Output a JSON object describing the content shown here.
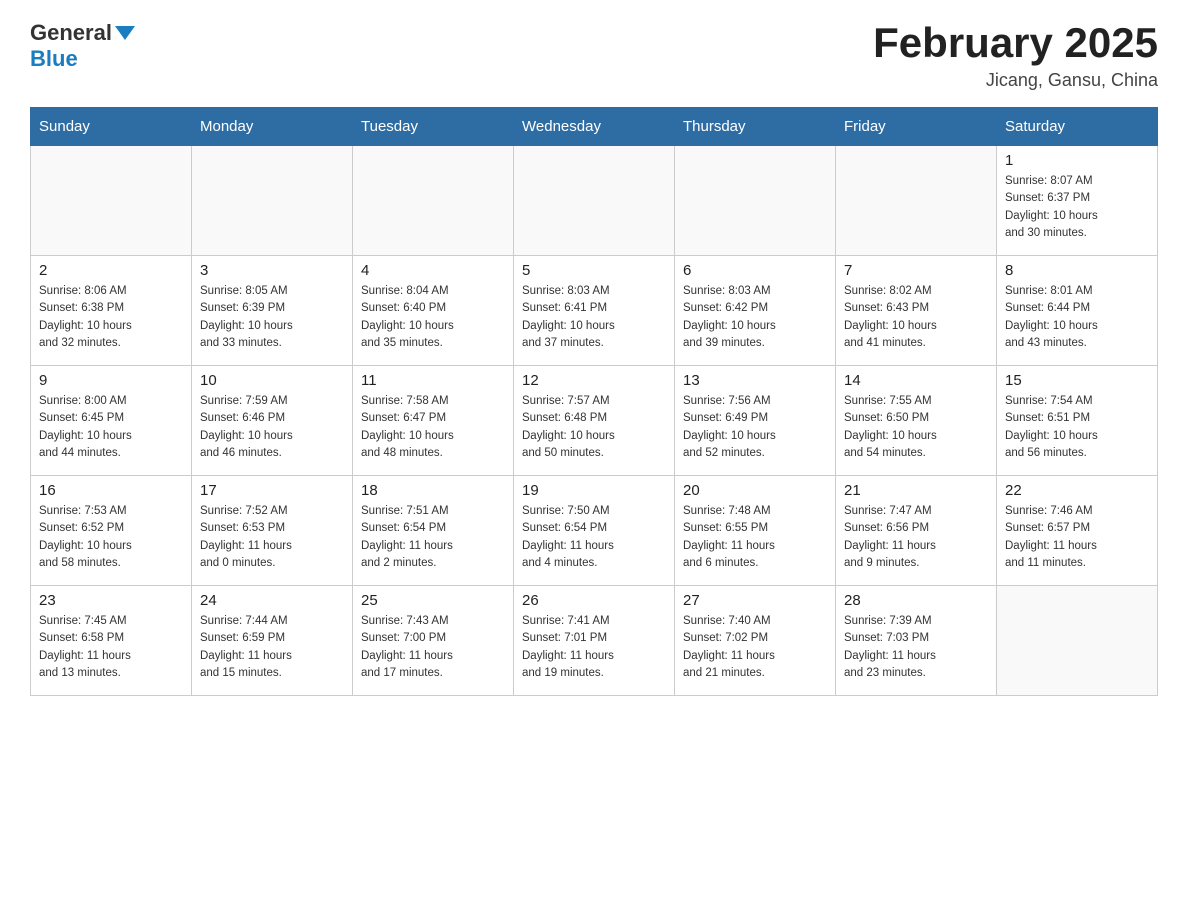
{
  "header": {
    "logo_general": "General",
    "logo_blue": "Blue",
    "month_title": "February 2025",
    "location": "Jicang, Gansu, China"
  },
  "days_of_week": [
    "Sunday",
    "Monday",
    "Tuesday",
    "Wednesday",
    "Thursday",
    "Friday",
    "Saturday"
  ],
  "weeks": [
    [
      {
        "day": "",
        "info": ""
      },
      {
        "day": "",
        "info": ""
      },
      {
        "day": "",
        "info": ""
      },
      {
        "day": "",
        "info": ""
      },
      {
        "day": "",
        "info": ""
      },
      {
        "day": "",
        "info": ""
      },
      {
        "day": "1",
        "info": "Sunrise: 8:07 AM\nSunset: 6:37 PM\nDaylight: 10 hours\nand 30 minutes."
      }
    ],
    [
      {
        "day": "2",
        "info": "Sunrise: 8:06 AM\nSunset: 6:38 PM\nDaylight: 10 hours\nand 32 minutes."
      },
      {
        "day": "3",
        "info": "Sunrise: 8:05 AM\nSunset: 6:39 PM\nDaylight: 10 hours\nand 33 minutes."
      },
      {
        "day": "4",
        "info": "Sunrise: 8:04 AM\nSunset: 6:40 PM\nDaylight: 10 hours\nand 35 minutes."
      },
      {
        "day": "5",
        "info": "Sunrise: 8:03 AM\nSunset: 6:41 PM\nDaylight: 10 hours\nand 37 minutes."
      },
      {
        "day": "6",
        "info": "Sunrise: 8:03 AM\nSunset: 6:42 PM\nDaylight: 10 hours\nand 39 minutes."
      },
      {
        "day": "7",
        "info": "Sunrise: 8:02 AM\nSunset: 6:43 PM\nDaylight: 10 hours\nand 41 minutes."
      },
      {
        "day": "8",
        "info": "Sunrise: 8:01 AM\nSunset: 6:44 PM\nDaylight: 10 hours\nand 43 minutes."
      }
    ],
    [
      {
        "day": "9",
        "info": "Sunrise: 8:00 AM\nSunset: 6:45 PM\nDaylight: 10 hours\nand 44 minutes."
      },
      {
        "day": "10",
        "info": "Sunrise: 7:59 AM\nSunset: 6:46 PM\nDaylight: 10 hours\nand 46 minutes."
      },
      {
        "day": "11",
        "info": "Sunrise: 7:58 AM\nSunset: 6:47 PM\nDaylight: 10 hours\nand 48 minutes."
      },
      {
        "day": "12",
        "info": "Sunrise: 7:57 AM\nSunset: 6:48 PM\nDaylight: 10 hours\nand 50 minutes."
      },
      {
        "day": "13",
        "info": "Sunrise: 7:56 AM\nSunset: 6:49 PM\nDaylight: 10 hours\nand 52 minutes."
      },
      {
        "day": "14",
        "info": "Sunrise: 7:55 AM\nSunset: 6:50 PM\nDaylight: 10 hours\nand 54 minutes."
      },
      {
        "day": "15",
        "info": "Sunrise: 7:54 AM\nSunset: 6:51 PM\nDaylight: 10 hours\nand 56 minutes."
      }
    ],
    [
      {
        "day": "16",
        "info": "Sunrise: 7:53 AM\nSunset: 6:52 PM\nDaylight: 10 hours\nand 58 minutes."
      },
      {
        "day": "17",
        "info": "Sunrise: 7:52 AM\nSunset: 6:53 PM\nDaylight: 11 hours\nand 0 minutes."
      },
      {
        "day": "18",
        "info": "Sunrise: 7:51 AM\nSunset: 6:54 PM\nDaylight: 11 hours\nand 2 minutes."
      },
      {
        "day": "19",
        "info": "Sunrise: 7:50 AM\nSunset: 6:54 PM\nDaylight: 11 hours\nand 4 minutes."
      },
      {
        "day": "20",
        "info": "Sunrise: 7:48 AM\nSunset: 6:55 PM\nDaylight: 11 hours\nand 6 minutes."
      },
      {
        "day": "21",
        "info": "Sunrise: 7:47 AM\nSunset: 6:56 PM\nDaylight: 11 hours\nand 9 minutes."
      },
      {
        "day": "22",
        "info": "Sunrise: 7:46 AM\nSunset: 6:57 PM\nDaylight: 11 hours\nand 11 minutes."
      }
    ],
    [
      {
        "day": "23",
        "info": "Sunrise: 7:45 AM\nSunset: 6:58 PM\nDaylight: 11 hours\nand 13 minutes."
      },
      {
        "day": "24",
        "info": "Sunrise: 7:44 AM\nSunset: 6:59 PM\nDaylight: 11 hours\nand 15 minutes."
      },
      {
        "day": "25",
        "info": "Sunrise: 7:43 AM\nSunset: 7:00 PM\nDaylight: 11 hours\nand 17 minutes."
      },
      {
        "day": "26",
        "info": "Sunrise: 7:41 AM\nSunset: 7:01 PM\nDaylight: 11 hours\nand 19 minutes."
      },
      {
        "day": "27",
        "info": "Sunrise: 7:40 AM\nSunset: 7:02 PM\nDaylight: 11 hours\nand 21 minutes."
      },
      {
        "day": "28",
        "info": "Sunrise: 7:39 AM\nSunset: 7:03 PM\nDaylight: 11 hours\nand 23 minutes."
      },
      {
        "day": "",
        "info": ""
      }
    ]
  ]
}
